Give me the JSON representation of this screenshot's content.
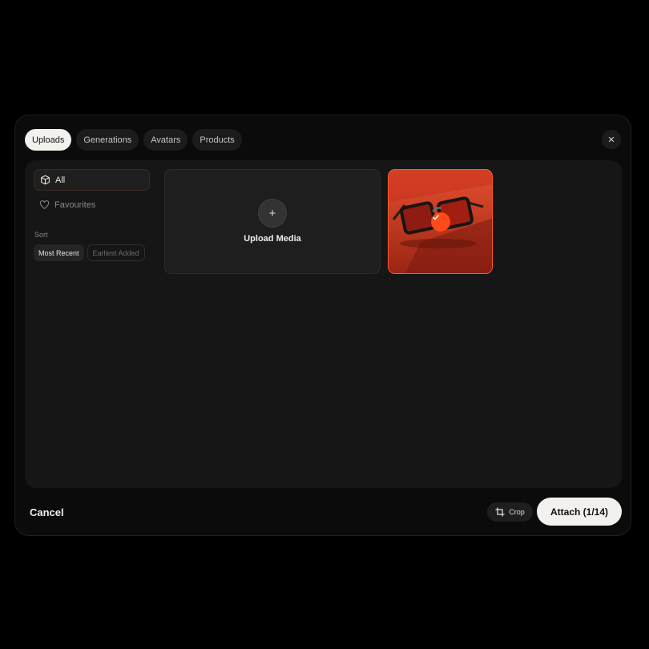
{
  "tabs": [
    {
      "label": "Uploads",
      "active": true
    },
    {
      "label": "Generations",
      "active": false
    },
    {
      "label": "Avatars",
      "active": false
    },
    {
      "label": "Products",
      "active": false
    }
  ],
  "close_icon": "close-icon",
  "sidebar": {
    "items": [
      {
        "label": "All",
        "icon": "cube-icon",
        "active": true
      },
      {
        "label": "Favourites",
        "icon": "heart-icon",
        "active": false
      }
    ],
    "sort_label": "Sort",
    "sort_options": [
      {
        "label": "Most Recent",
        "active": true
      },
      {
        "label": "Earliest Added",
        "active": false
      }
    ]
  },
  "upload": {
    "label": "Upload Media",
    "icon": "plus-icon"
  },
  "media": [
    {
      "subject": "red sunglasses on red background",
      "selected": true
    }
  ],
  "footer": {
    "cancel_label": "Cancel",
    "crop_label": "Crop",
    "attach_label": "Attach (1/14)"
  },
  "colors": {
    "accent": "#ff4a1a",
    "background": "#000000",
    "modal": "#0b0b0b",
    "panel": "#161616"
  }
}
